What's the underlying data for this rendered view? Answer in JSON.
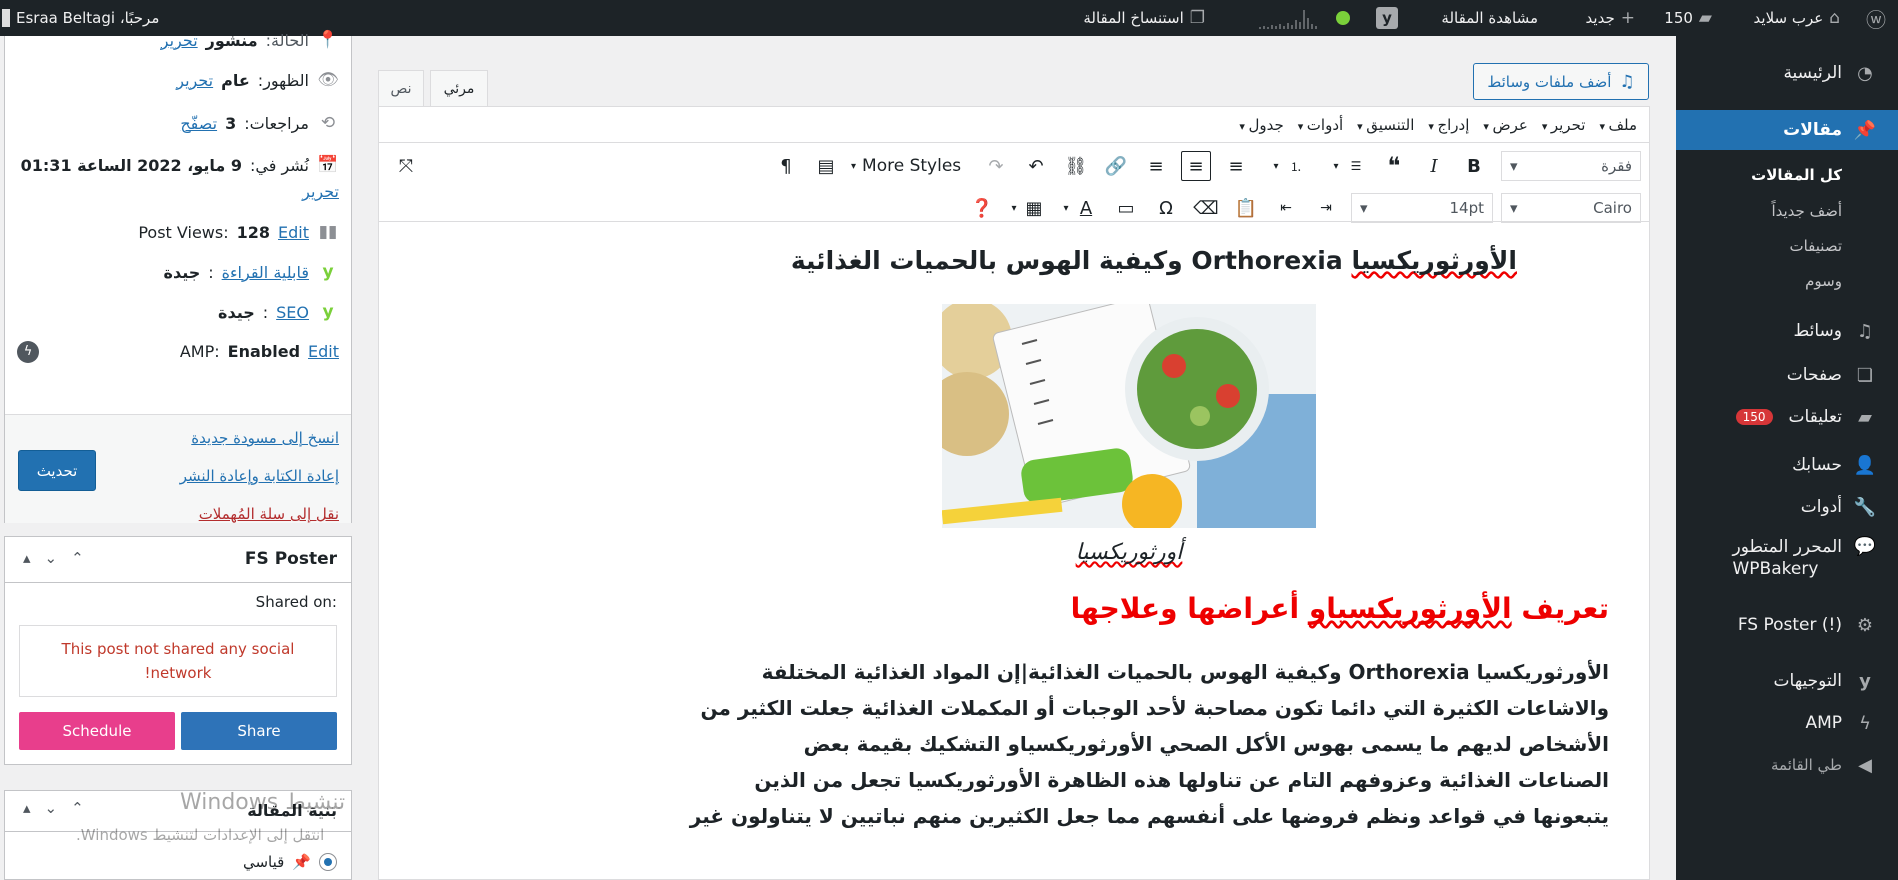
{
  "adminbar": {
    "site_name": "عرب سلايد",
    "comments_count": "150",
    "new_label": "جديد",
    "view_post": "مشاهدة المقالة",
    "duplicate": "استنساخ المقالة",
    "greeting": "مرحبًا، Esraa Beltagi"
  },
  "sidebar": {
    "items": [
      {
        "label": "الرئيسية",
        "icon": "dashboard-icon"
      },
      {
        "label": "مقالات",
        "icon": "pin-icon"
      },
      {
        "label": "وسائط",
        "icon": "media-icon"
      },
      {
        "label": "صفحات",
        "icon": "pages-icon"
      },
      {
        "label": "تعليقات",
        "icon": "comment-icon",
        "badge": "150"
      },
      {
        "label": "حسابك",
        "icon": "user-icon"
      },
      {
        "label": "أدوات",
        "icon": "wrench-icon"
      },
      {
        "label": "المحرر المتطور",
        "label2": "WPBakery",
        "icon": "chat-icon"
      },
      {
        "label": "FS Poster (!)",
        "icon": "gear-icon"
      },
      {
        "label": "التوجيهات",
        "icon": "yoast-icon"
      },
      {
        "label": "AMP",
        "icon": "amp-icon"
      },
      {
        "label": "طي القائمة",
        "icon": "collapse-icon"
      }
    ],
    "submenu": [
      "كل المقالات",
      "أضف جديداً",
      "تصنيفات",
      "وسوم"
    ]
  },
  "publish": {
    "status_label": "الحالة:",
    "status_value": "منشور",
    "edit": "تحرير",
    "visibility_label": "الظهور:",
    "visibility_value": "عام",
    "revisions_label": "مراجعات:",
    "revisions_value": "3",
    "browse": "تصفّح",
    "published_label": "نُشر في:",
    "published_value": "9 مايو، 2022 الساعة 01:31",
    "views_label": "Post Views:",
    "views_value": "128",
    "views_edit": "Edit",
    "readability_label": "قابلية القراءة",
    "readability_value": "جيدة",
    "seo_label": "SEO",
    "seo_value": "جيدة",
    "amp_label": "AMP:",
    "amp_value": "Enabled",
    "amp_edit": "Edit",
    "copy_draft": "انسخ إلى مسودة جديدة",
    "rewrite": "إعادة الكتابة وإعادة النشر",
    "trash": "نقل إلى سلة المُهملات",
    "update": "تحديث"
  },
  "fsposter": {
    "title": "FS Poster",
    "shared_on": "Shared on:",
    "not_shared_1": "This post not shared any social",
    "not_shared_2": "network!",
    "schedule": "Schedule",
    "share": "Share"
  },
  "format_box": {
    "title": "بنية المقالة",
    "option": "قياسي"
  },
  "watermark": {
    "line1": "تنشيط Windows",
    "line2": "انتقل إلى الإعدادات لتنشيط Windows."
  },
  "editor": {
    "add_media": "أضف ملفات وسائط",
    "tab_visual": "مرئي",
    "tab_text": "نص",
    "menus": [
      "ملف",
      "تحرير",
      "عرض",
      "إدراج",
      "التنسيق",
      "أدوات",
      "جدول"
    ],
    "format_select": "فقرة",
    "more_styles": "More Styles",
    "font_family": "Cairo",
    "font_size": "14pt"
  },
  "content": {
    "heading_word": "الأورثوريكسيا",
    "heading_rest": " Orthorexia وكيفية الهوس بالحميات الغذائية",
    "caption": "أورثوريكسيا",
    "subheading_a": "تعريف ",
    "subheading_b": "الأورثوريكسياو",
    "subheading_c": " أعراضها وعلاجها",
    "para_lines": [
      "الأورثوريكسيا Orthorexia وكيفية الهوس بالحميات الغذائية|إن المواد الغذائية المختلفة",
      "والاشاعات الكثيرة التي دائما تكون مصاحبة لأحد الوجبات أو المكملات الغذائية جعلت الكثير من",
      "الأشخاص لديهم ما يسمى بهوس الأكل الصحي  الأورثوريكسياو التشكيك بقيمة بعض",
      "الصناعات الغذائية وعزوفهم التام عن تناولها  هذه الظاهرة  الأورثوريكسيا تجعل من الذين",
      "يتبعونها في قواعد ونظم فروضها على أنفسهم مما جعل الكثيرين منهم نباتيين لا يتناولون غير"
    ]
  }
}
